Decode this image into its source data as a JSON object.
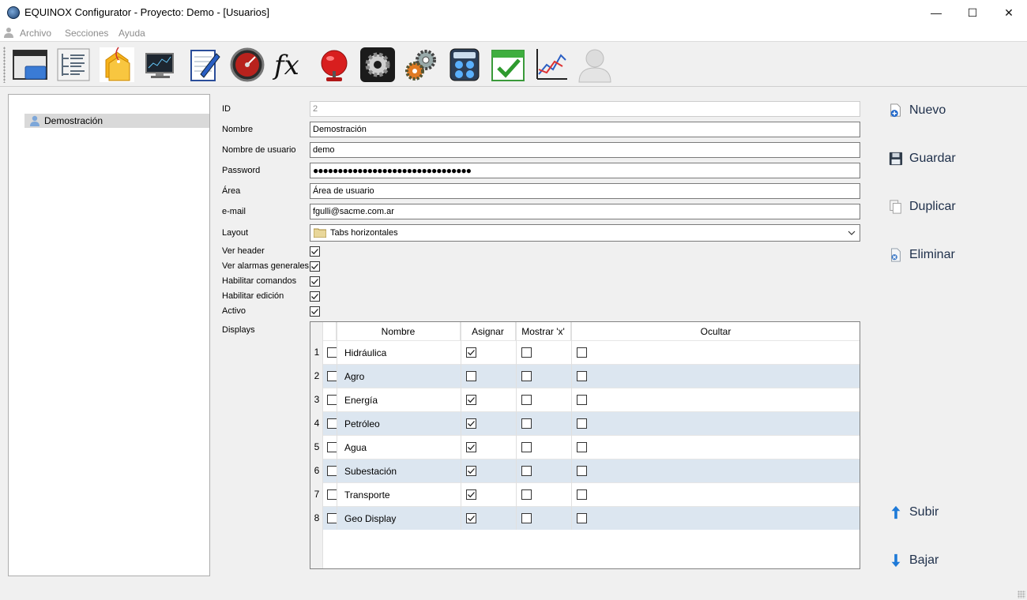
{
  "window": {
    "title": "EQUINOX Configurator - Proyecto: Demo - [Usuarios]",
    "minimize": "—",
    "maximize": "☐",
    "close": "✕"
  },
  "menu": [
    "Archivo",
    "Secciones",
    "Ayuda"
  ],
  "mdi": {
    "minimize": "–",
    "restore": "❐",
    "close": "✕"
  },
  "toolbar": {
    "icons": [
      "displays-window-icon",
      "tree-list-icon",
      "tags-icon",
      "monitor-icon",
      "notepad-pen-icon",
      "gauge-icon",
      "fx-formula-icon",
      "alarm-bell-icon",
      "settings-gear-icon",
      "services-gears-icon",
      "calculator-icon",
      "calendar-check-icon",
      "trend-chart-icon",
      "users-icon"
    ]
  },
  "tree": {
    "items": [
      "Demostración"
    ]
  },
  "form": {
    "labels": {
      "id": "ID",
      "nombre": "Nombre",
      "usuario": "Nombre de usuario",
      "password": "Password",
      "area": "Área",
      "email": "e-mail",
      "layout": "Layout",
      "ver_header": "Ver header",
      "ver_alarmas": "Ver alarmas generales",
      "habilitar_comandos": "Habilitar comandos",
      "habilitar_edicion": "Habilitar edición",
      "activo": "Activo",
      "displays": "Displays"
    },
    "values": {
      "id": "2",
      "nombre": "Demostración",
      "usuario": "demo",
      "password": "●●●●●●●●●●●●●●●●●●●●●●●●●●●●●●●●",
      "area": "Área de usuario",
      "email": "fgulli@sacme.com.ar",
      "layout": "Tabs horizontales"
    },
    "checks": {
      "ver_header": true,
      "ver_alarmas": true,
      "habilitar_comandos": true,
      "habilitar_edicion": true,
      "activo": true
    }
  },
  "displays": {
    "columns": [
      "Nombre",
      "Asignar",
      "Mostrar 'x'",
      "Ocultar"
    ],
    "rows": [
      {
        "n": "1",
        "sel": false,
        "nombre": "Hidráulica",
        "asignar": true,
        "mostrar_x": false,
        "ocultar": false
      },
      {
        "n": "2",
        "sel": false,
        "nombre": "Agro",
        "asignar": false,
        "mostrar_x": false,
        "ocultar": false
      },
      {
        "n": "3",
        "sel": false,
        "nombre": "Energía",
        "asignar": true,
        "mostrar_x": false,
        "ocultar": false
      },
      {
        "n": "4",
        "sel": false,
        "nombre": "Petróleo",
        "asignar": true,
        "mostrar_x": false,
        "ocultar": false
      },
      {
        "n": "5",
        "sel": false,
        "nombre": "Agua",
        "asignar": true,
        "mostrar_x": false,
        "ocultar": false
      },
      {
        "n": "6",
        "sel": false,
        "nombre": "Subestación",
        "asignar": true,
        "mostrar_x": false,
        "ocultar": false
      },
      {
        "n": "7",
        "sel": false,
        "nombre": "Transporte",
        "asignar": true,
        "mostrar_x": false,
        "ocultar": false
      },
      {
        "n": "8",
        "sel": false,
        "nombre": "Geo Display",
        "asignar": true,
        "mostrar_x": false,
        "ocultar": false
      }
    ]
  },
  "actions": {
    "nuevo": "Nuevo",
    "guardar": "Guardar",
    "duplicar": "Duplicar",
    "eliminar": "Eliminar",
    "subir": "Subir",
    "bajar": "Bajar"
  }
}
